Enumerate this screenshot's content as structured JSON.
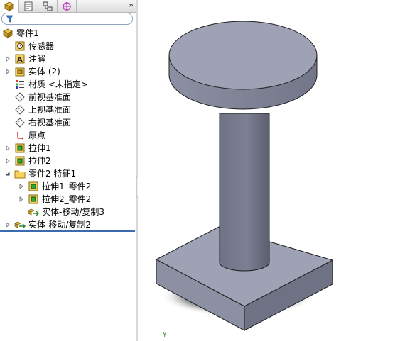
{
  "tabs": [
    {
      "name": "feature-manager-icon"
    },
    {
      "name": "property-manager-icon"
    },
    {
      "name": "configuration-manager-icon"
    },
    {
      "name": "dimxpert-icon"
    }
  ],
  "tree": {
    "root": "零件1",
    "items": [
      {
        "label": "传感器"
      },
      {
        "label": "注解"
      },
      {
        "label": "实体 (2)"
      },
      {
        "label": "材质 <未指定>"
      },
      {
        "label": "前视基准面"
      },
      {
        "label": "上视基准面"
      },
      {
        "label": "右视基准面"
      },
      {
        "label": "原点"
      },
      {
        "label": "拉伸1"
      },
      {
        "label": "拉伸2"
      },
      {
        "label": "零件2 特征1"
      },
      {
        "label": "拉伸1_零件2"
      },
      {
        "label": "拉伸2_零件2"
      },
      {
        "label": "实体-移动/复制3"
      },
      {
        "label": "实体-移动/复制2"
      }
    ]
  },
  "viewport": {
    "triad_label": "Y"
  },
  "colors": {
    "model_top": "#9ea2b4",
    "model_side_light": "#8c90a2",
    "model_side_dark": "#6e7284",
    "edge": "#202020",
    "rollback_bar": "#3a6ab0"
  }
}
